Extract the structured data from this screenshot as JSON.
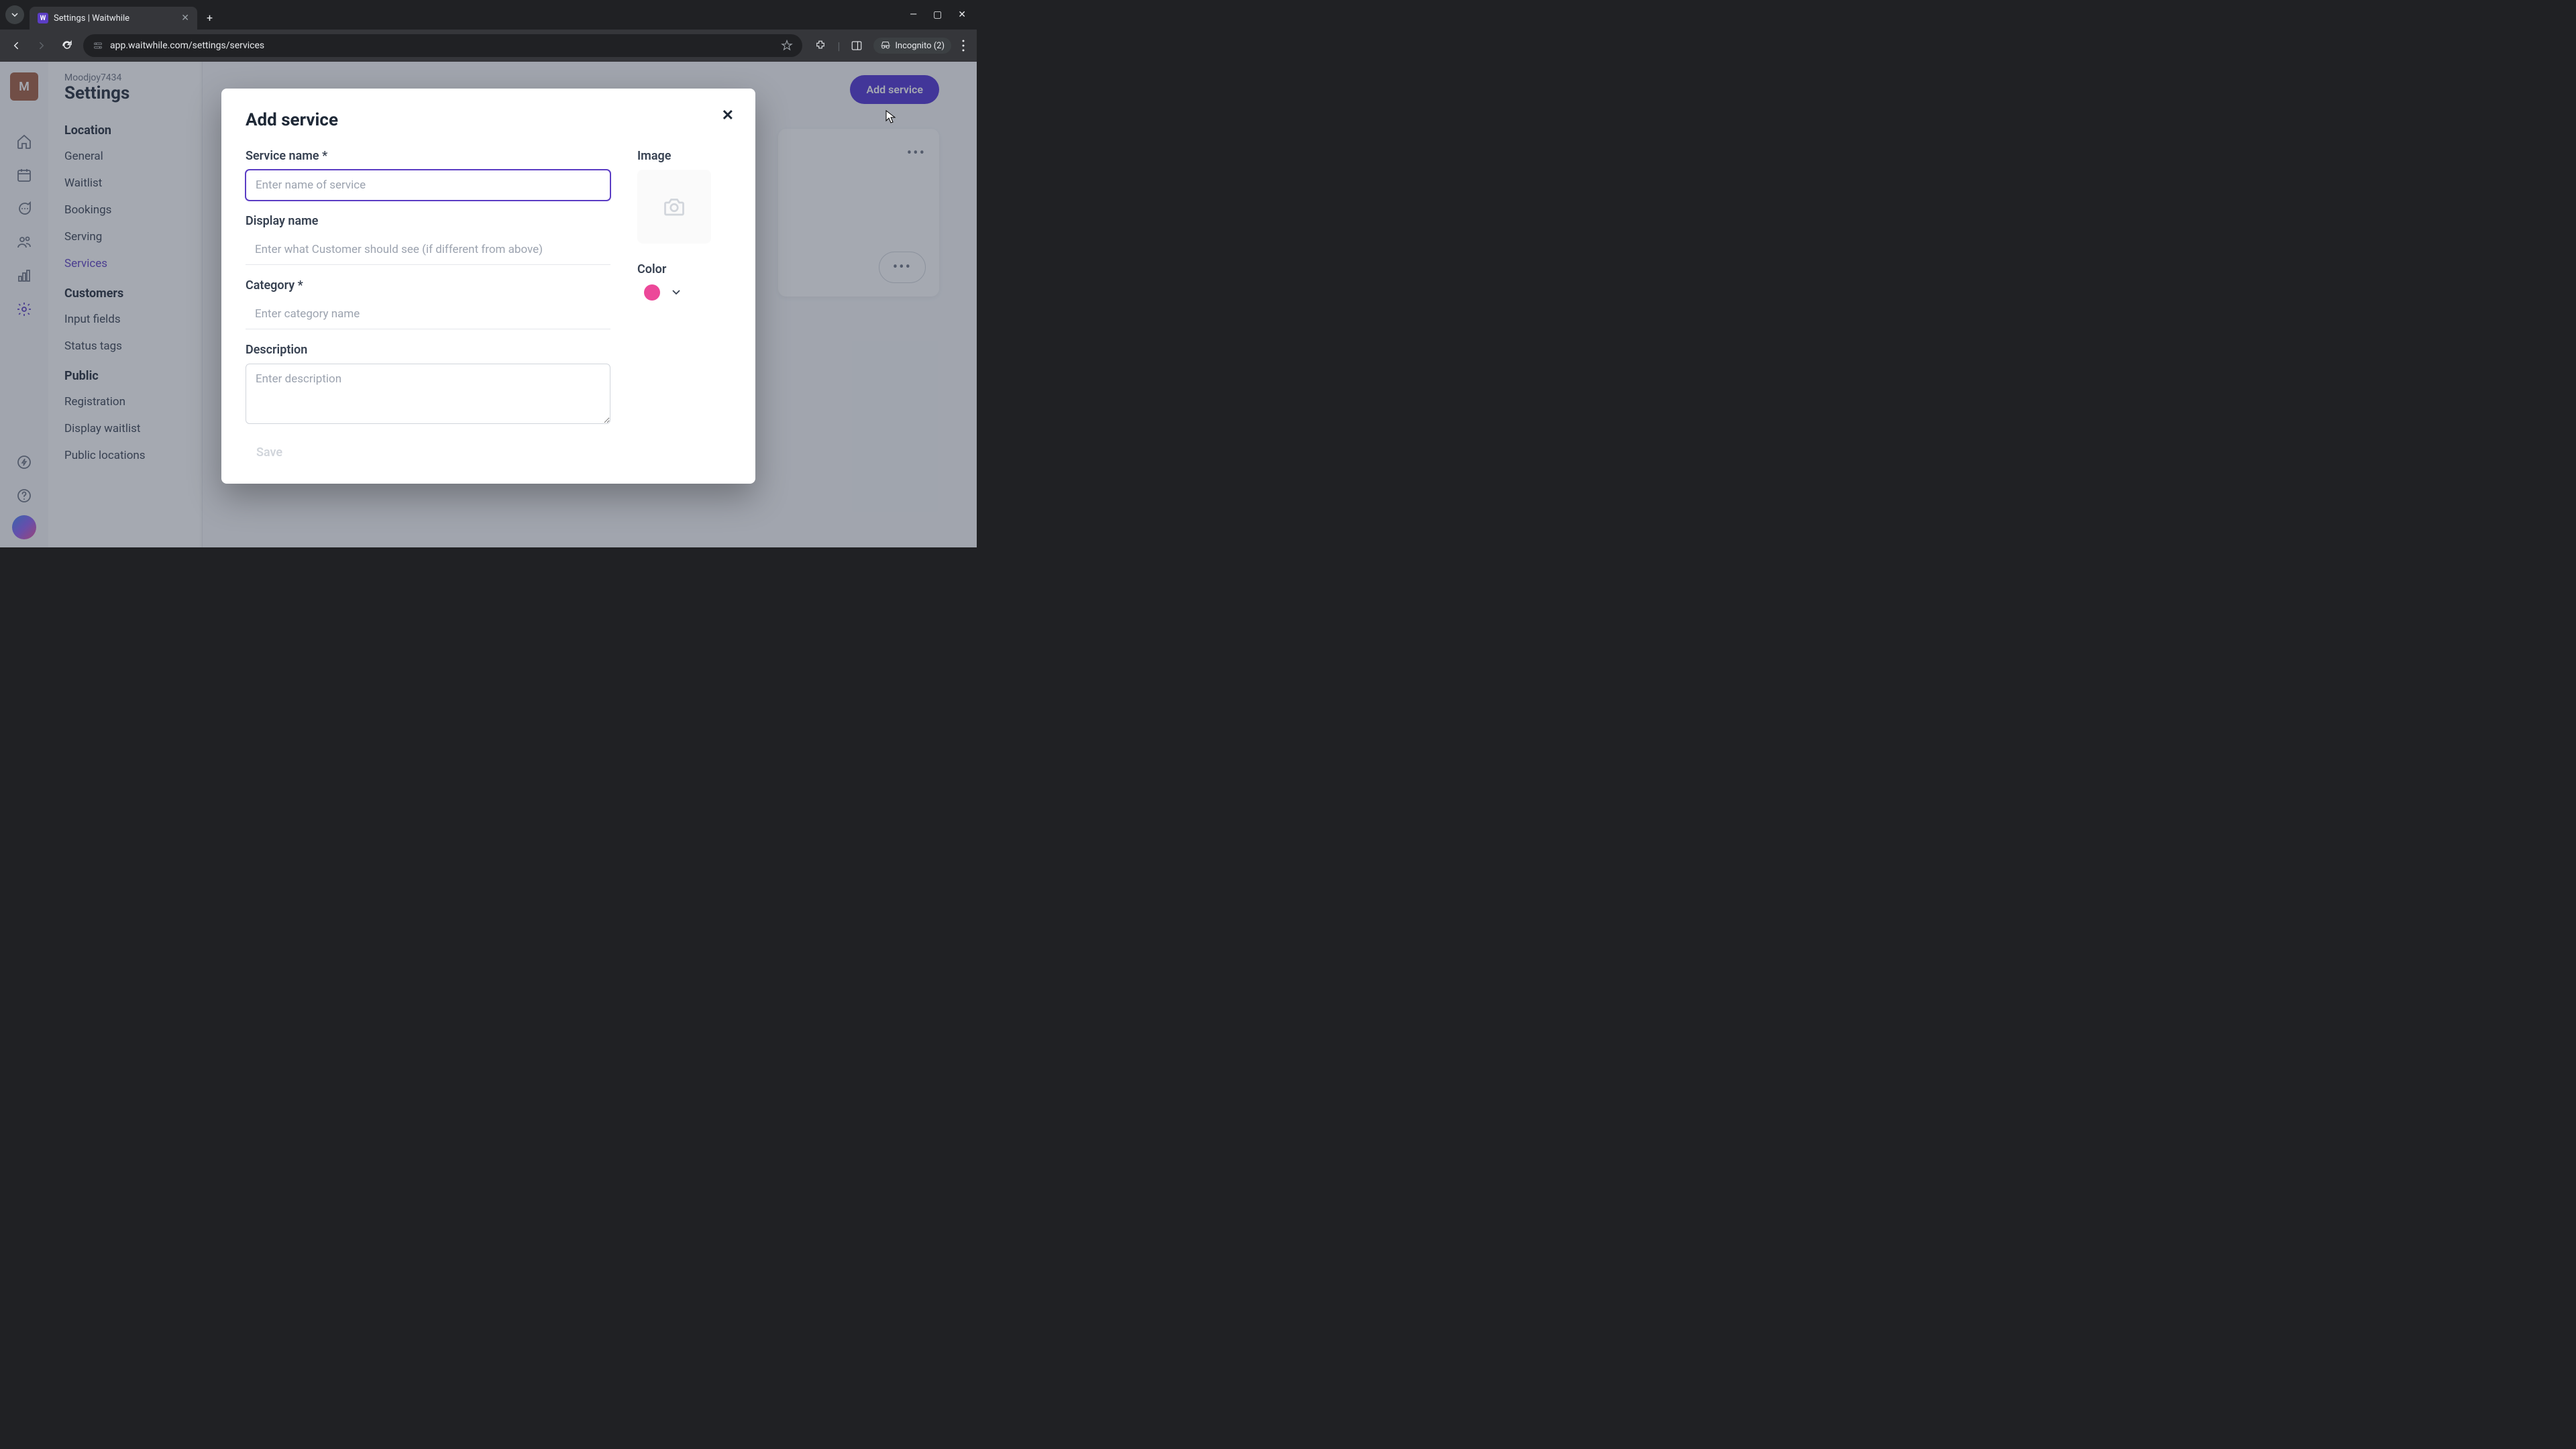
{
  "browser": {
    "tab_title": "Settings | Waitwhile",
    "url": "app.waitwhile.com/settings/services",
    "incognito_label": "Incognito (2)"
  },
  "icon_rail": {
    "avatar_letter": "M"
  },
  "sidebar": {
    "org_name": "Moodjoy7434",
    "page_title": "Settings",
    "sections": {
      "location": {
        "title": "Location",
        "items": [
          "General",
          "Waitlist",
          "Bookings",
          "Serving",
          "Services"
        ]
      },
      "customers": {
        "title": "Customers",
        "items": [
          "Input fields",
          "Status tags"
        ]
      },
      "public": {
        "title": "Public",
        "items": [
          "Registration",
          "Display waitlist",
          "Public locations"
        ]
      }
    }
  },
  "main": {
    "add_button": "Add service"
  },
  "modal": {
    "title": "Add service",
    "service_name_label": "Service name *",
    "service_name_placeholder": "Enter name of service",
    "display_name_label": "Display name",
    "display_name_placeholder": "Enter what Customer should see (if different from above)",
    "category_label": "Category *",
    "category_placeholder": "Enter category name",
    "description_label": "Description",
    "description_placeholder": "Enter description",
    "image_label": "Image",
    "color_label": "Color",
    "color_value": "#ec4899",
    "save_label": "Save"
  }
}
